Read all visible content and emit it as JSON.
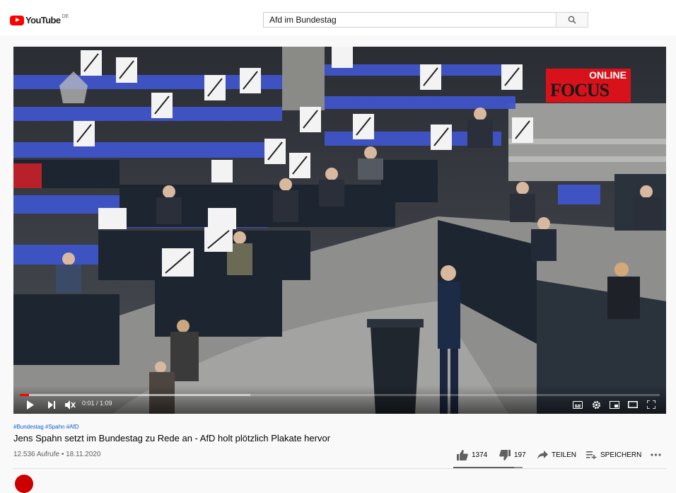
{
  "brand": {
    "name": "YouTube",
    "country": "DE",
    "color": "#ff0000"
  },
  "search": {
    "value": "Afd im Bundestag",
    "icon": "search-icon"
  },
  "player": {
    "time": "0:01 / 1:09",
    "progress_fraction": 0.014,
    "buffered_fraction": 0.36,
    "overlay": {
      "line1": "ONLINE",
      "line2": "FOCUS",
      "color": "#d8121a"
    },
    "controls": [
      "play-icon",
      "next-icon",
      "mute-icon",
      "subtitles-icon",
      "gear-icon",
      "miniplayer-icon",
      "theater-icon",
      "fullscreen-icon"
    ]
  },
  "video": {
    "hashtags": "#Bundestag #Spahn #AfD",
    "title": "Jens Spahn setzt im Bundestag zu Rede an - AfD holt plötzlich Plakate hervor",
    "meta": "12.536 Aufrufe • 18.11.2020",
    "likes": "1374",
    "dislikes": "197",
    "share_label": "TEILEN",
    "save_label": "SPEICHERN",
    "like_ratio": 0.875
  }
}
